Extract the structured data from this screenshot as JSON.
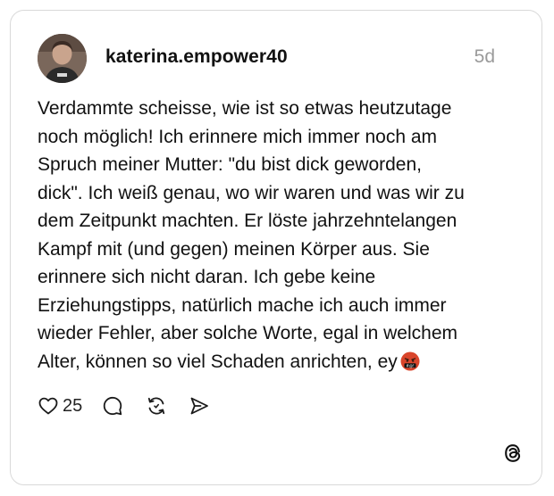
{
  "post": {
    "username": "katerina.empower40",
    "timestamp": "5d",
    "text": "Verdammte scheisse, wie ist so etwas heutzutage\nnoch möglich! Ich erinnere mich immer noch am\nSpruch meiner Mutter: \"du bist dick geworden,\ndick\". Ich weiß genau, wo wir waren und was wir zu\ndem Zeitpunkt machten. Er löste jahrzehntelangen\nKampf mit (und gegen) meinen Körper aus. Sie\nerinnere sich nicht daran. Ich gebe keine\nErziehungstipps, natürlich mache ich auch immer\nwieder Fehler, aber solche Worte, egal in welchem\nAlter, können so viel Schaden anrichten, ey",
    "emoji": "face-with-symbols-on-mouth"
  },
  "actions": {
    "like_count": "25",
    "like_icon": "heart-icon",
    "reply_icon": "comment-icon",
    "repost_icon": "repost-icon",
    "share_icon": "send-icon"
  },
  "branding": {
    "logo_icon": "threads-logo-icon"
  },
  "colors": {
    "text": "#111111",
    "muted": "#9a9a9a",
    "border": "#d9d9d9",
    "emoji_face": "#d9452b",
    "background": "#ffffff"
  }
}
